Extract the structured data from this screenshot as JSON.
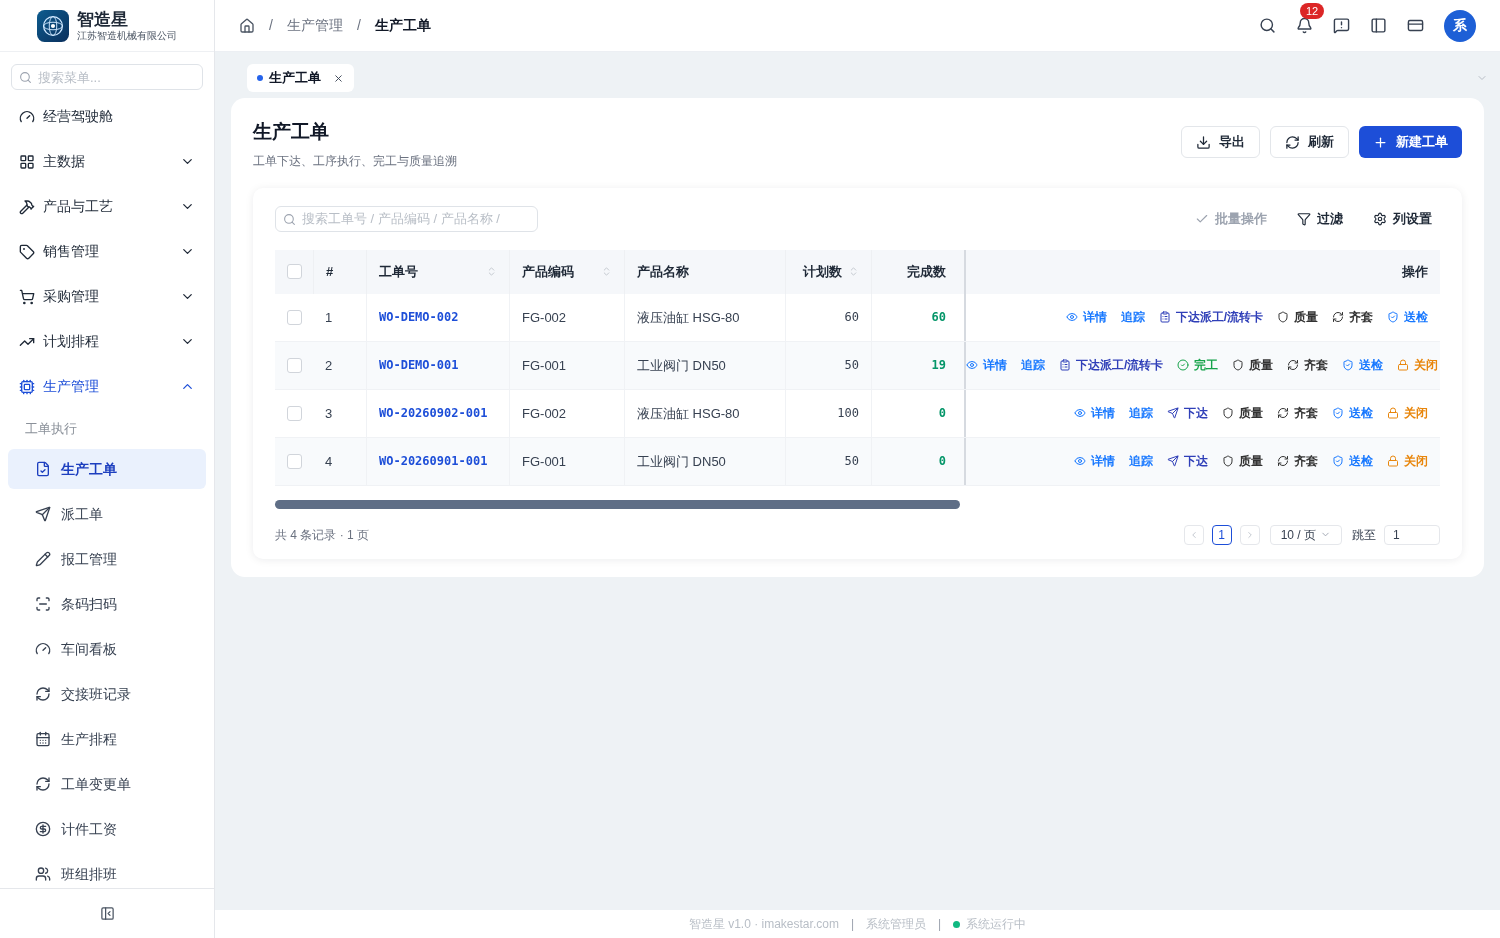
{
  "brand": {
    "name": "智造星",
    "company": "江苏智造机械有限公司"
  },
  "sidebar": {
    "search_placeholder": "搜索菜单...",
    "items": [
      {
        "label": "经营驾驶舱",
        "selected": false
      },
      {
        "label": "主数据",
        "selected": false,
        "expanded": false
      },
      {
        "label": "产品与工艺",
        "selected": false,
        "expanded": false
      },
      {
        "label": "销售管理",
        "selected": false,
        "expanded": false
      },
      {
        "label": "采购管理",
        "selected": false,
        "expanded": false
      },
      {
        "label": "计划排程",
        "selected": false,
        "expanded": false
      },
      {
        "label": "生产管理",
        "selected": true,
        "expanded": true,
        "children": [
          {
            "label": "工单执行",
            "children": [
              {
                "label": "生产工单",
                "selected": true
              },
              {
                "label": "派工单",
                "selected": false
              },
              {
                "label": "报工管理",
                "selected": false
              },
              {
                "label": "条码扫码",
                "selected": false
              },
              {
                "label": "车间看板",
                "selected": false
              },
              {
                "label": "交接班记录",
                "selected": false
              },
              {
                "label": "生产排程",
                "selected": false
              },
              {
                "label": "工单变更单",
                "selected": false
              },
              {
                "label": "计件工资",
                "selected": false
              },
              {
                "label": "班组排班",
                "selected": false
              }
            ]
          }
        ]
      }
    ]
  },
  "header": {
    "breadcrumb_separator": "/",
    "breadcrumb": [
      "生产管理",
      "生产工单"
    ],
    "notification_count": "12",
    "avatar": "系"
  },
  "tabs": [
    {
      "label": "生产工单",
      "selected": true
    }
  ],
  "page": {
    "title": "生产工单",
    "subtitle": "工单下达、工序执行、完工与质量追溯",
    "buttons": [
      {
        "kind": "export",
        "label": "导出"
      },
      {
        "kind": "refresh",
        "label": "刷新"
      },
      {
        "kind": "create",
        "label": "新建工单"
      }
    ]
  },
  "toolbar": {
    "search_placeholder": "搜索工单号 / 产品编码 / 产品名称 /",
    "actions": [
      {
        "kind": "batch",
        "label": "批量操作",
        "disabled": true
      },
      {
        "kind": "filter",
        "label": "过滤",
        "disabled": false
      },
      {
        "kind": "columns",
        "label": "列设置",
        "disabled": false
      }
    ]
  },
  "table": {
    "select_all": {
      "checked": false
    },
    "columns": [
      {
        "label": "#",
        "sortable": false
      },
      {
        "label": "工单号",
        "sortable": true
      },
      {
        "label": "产品编码",
        "sortable": true
      },
      {
        "label": "产品名称",
        "sortable": false
      },
      {
        "label": "计划数",
        "sortable": true
      },
      {
        "label": "完成数",
        "sortable": false
      },
      {
        "label": "操作",
        "sortable": false
      }
    ],
    "rows": [
      {
        "checked": false,
        "index": "1",
        "order_no": "WO-DEMO-002",
        "product_code": "FG-002",
        "product_name": "液压油缸 HSG-80",
        "planned": "60",
        "completed": "60",
        "actions": [
          {
            "kind": "detail",
            "label": "详情"
          },
          {
            "kind": "trace",
            "label": "追踪"
          },
          {
            "kind": "card",
            "label": "下达派工/流转卡"
          },
          {
            "kind": "quality",
            "label": "质量"
          },
          {
            "kind": "kit",
            "label": "齐套"
          },
          {
            "kind": "inspect",
            "label": "送检"
          }
        ]
      },
      {
        "checked": false,
        "index": "2",
        "order_no": "WO-DEMO-001",
        "product_code": "FG-001",
        "product_name": "工业阀门 DN50",
        "planned": "50",
        "completed": "19",
        "actions": [
          {
            "kind": "detail",
            "label": "详情"
          },
          {
            "kind": "trace",
            "label": "追踪"
          },
          {
            "kind": "card",
            "label": "下达派工/流转卡"
          },
          {
            "kind": "complete",
            "label": "完工"
          },
          {
            "kind": "quality",
            "label": "质量"
          },
          {
            "kind": "kit",
            "label": "齐套"
          },
          {
            "kind": "inspect",
            "label": "送检"
          },
          {
            "kind": "close",
            "label": "关闭"
          }
        ]
      },
      {
        "checked": false,
        "index": "3",
        "order_no": "WO-20260902-001",
        "product_code": "FG-002",
        "product_name": "液压油缸 HSG-80",
        "planned": "100",
        "completed": "0",
        "actions": [
          {
            "kind": "detail",
            "label": "详情"
          },
          {
            "kind": "trace",
            "label": "追踪"
          },
          {
            "kind": "release",
            "label": "下达"
          },
          {
            "kind": "quality",
            "label": "质量"
          },
          {
            "kind": "kit",
            "label": "齐套"
          },
          {
            "kind": "inspect",
            "label": "送检"
          },
          {
            "kind": "close",
            "label": "关闭"
          }
        ]
      },
      {
        "checked": false,
        "index": "4",
        "order_no": "WO-20260901-001",
        "product_code": "FG-001",
        "product_name": "工业阀门 DN50",
        "planned": "50",
        "completed": "0",
        "actions": [
          {
            "kind": "detail",
            "label": "详情"
          },
          {
            "kind": "trace",
            "label": "追踪"
          },
          {
            "kind": "release",
            "label": "下达"
          },
          {
            "kind": "quality",
            "label": "质量"
          },
          {
            "kind": "kit",
            "label": "齐套"
          },
          {
            "kind": "inspect",
            "label": "送检"
          },
          {
            "kind": "close",
            "label": "关闭"
          }
        ]
      }
    ]
  },
  "pagination": {
    "summary": "共 4 条记录 · 1 页",
    "pages": [
      {
        "label": "1",
        "selected": true
      }
    ],
    "page_size": "10 / 页",
    "jump_label": "跳至",
    "jump_value": "1"
  },
  "footer": {
    "version": "智造星 v1.0 · imakestar.com",
    "user": "系统管理员",
    "separator": "|",
    "status": "系统运行中"
  }
}
